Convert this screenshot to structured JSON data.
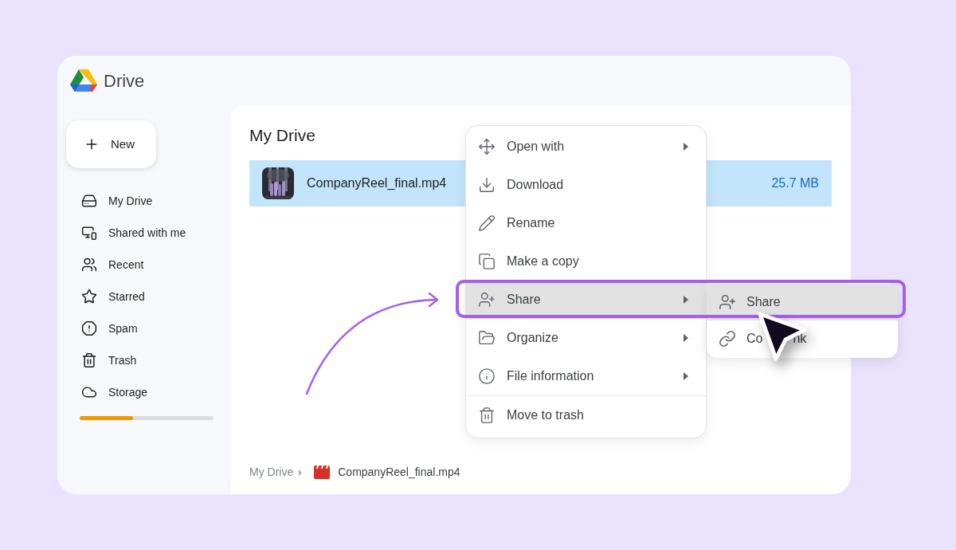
{
  "app": {
    "name": "Drive"
  },
  "new_button": {
    "label": "New"
  },
  "sidebar": {
    "items": [
      {
        "label": "My Drive"
      },
      {
        "label": "Shared with me"
      },
      {
        "label": "Recent"
      },
      {
        "label": "Starred"
      },
      {
        "label": "Spam"
      },
      {
        "label": "Trash"
      },
      {
        "label": "Storage"
      }
    ],
    "storage": {
      "level": 0.4
    }
  },
  "main": {
    "title": "My Drive",
    "files": [
      {
        "name": "CompanyReel_final.mp4",
        "size": "25.7 MB",
        "selected": true
      }
    ],
    "breadcrumb": [
      {
        "label": "My Drive"
      },
      {
        "label": "CompanyReel_final.mp4",
        "kind": "video"
      }
    ]
  },
  "context_menu": {
    "items": [
      {
        "label": "Open with",
        "has_submenu": true,
        "selected": false,
        "divider_before": false
      },
      {
        "label": "Download",
        "has_submenu": false,
        "selected": false,
        "divider_before": false
      },
      {
        "label": "Rename",
        "has_submenu": false,
        "selected": false,
        "divider_before": false
      },
      {
        "label": "Make a copy",
        "has_submenu": false,
        "selected": false,
        "divider_before": false
      },
      {
        "label": "Share",
        "has_submenu": true,
        "selected": true,
        "divider_before": false
      },
      {
        "label": "Organize",
        "has_submenu": true,
        "selected": false,
        "divider_before": false
      },
      {
        "label": "File information",
        "has_submenu": true,
        "selected": false,
        "divider_before": false
      },
      {
        "label": "Move to trash",
        "has_submenu": false,
        "selected": false,
        "divider_before": true
      }
    ]
  },
  "submenu": {
    "items": [
      {
        "parts": [
          "Share"
        ],
        "selected": true
      },
      {
        "parts": [
          "Co",
          "nk"
        ],
        "selected": false
      }
    ]
  }
}
